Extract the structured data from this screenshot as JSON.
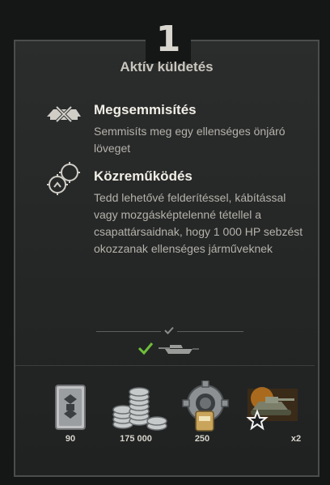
{
  "mission": {
    "number": "1",
    "title": "Aktív küldetés"
  },
  "conditions": [
    {
      "icon": "destroy-spg-icon",
      "title": "Megsemmisítés",
      "description": "Semmisíts meg egy ellenséges önjáró löveget"
    },
    {
      "icon": "assistance-crosshair-icon",
      "title": "Közreműködés",
      "description": "Tedd lehetővé felderítéssel, kábítással vagy mozgásképtelenné tétellel a csapattársaidnak, hogy 1 000 HP sebzést okozzanak ellenséges járműveknek"
    }
  ],
  "progress": {
    "icons": [
      "check-icon",
      "tank-icon"
    ]
  },
  "rewards": [
    {
      "icon": "bond-card-icon",
      "value": "90"
    },
    {
      "icon": "credits-coins-icon",
      "value": "175 000"
    },
    {
      "icon": "equipment-gear-icon",
      "value": "250"
    },
    {
      "icon": "tank-reward-icon",
      "value": "x2"
    }
  ],
  "colors": {
    "accent_green": "#6fbf3a",
    "panel_border": "#4b4d4c",
    "background": "#151616"
  }
}
